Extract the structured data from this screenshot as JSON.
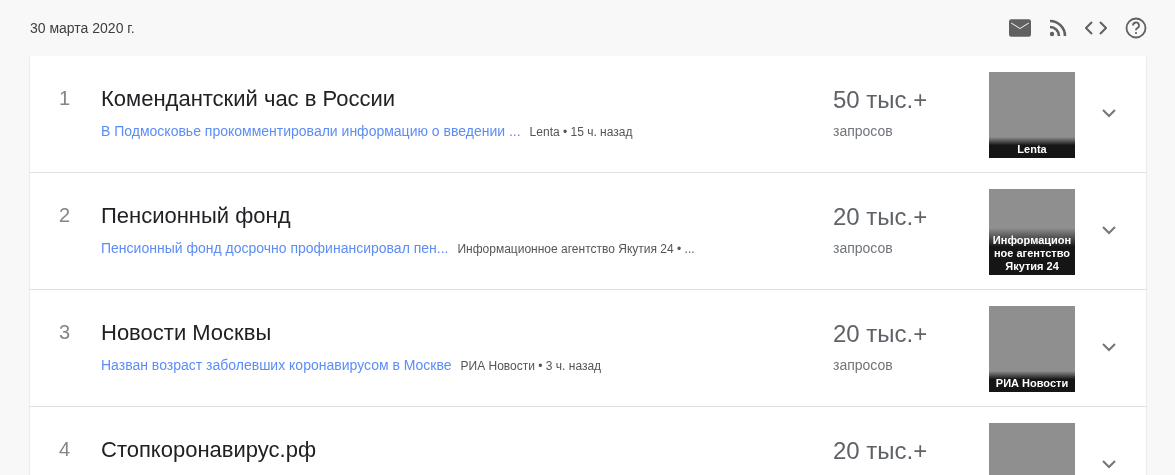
{
  "header": {
    "date": "30 марта 2020 г."
  },
  "items": [
    {
      "rank": "1",
      "title": "Комендантский час в России",
      "link": "В Подмосковье прокомментировали информацию о введении ...",
      "source": "Lenta • 15 ч. назад",
      "count": "50 тыс.+",
      "count_label": "запросов",
      "image_caption": "Lenta"
    },
    {
      "rank": "2",
      "title": "Пенсионный фонд",
      "link": "Пенсионный фонд досрочно профинансировал пен...",
      "source": "Информационное агентство Якутия 24 • ...",
      "count": "20 тыс.+",
      "count_label": "запросов",
      "image_caption": "Информационное агентство Якутия 24"
    },
    {
      "rank": "3",
      "title": "Новости Москвы",
      "link": "Назван возраст заболевших коронавирусом в Москве",
      "source": "РИА Новости • 3 ч. назад",
      "count": "20 тыс.+",
      "count_label": "запросов",
      "image_caption": "РИА Новости"
    },
    {
      "rank": "4",
      "title": "Стопкоронавирус.рф",
      "count": "20 тыс.+"
    }
  ]
}
